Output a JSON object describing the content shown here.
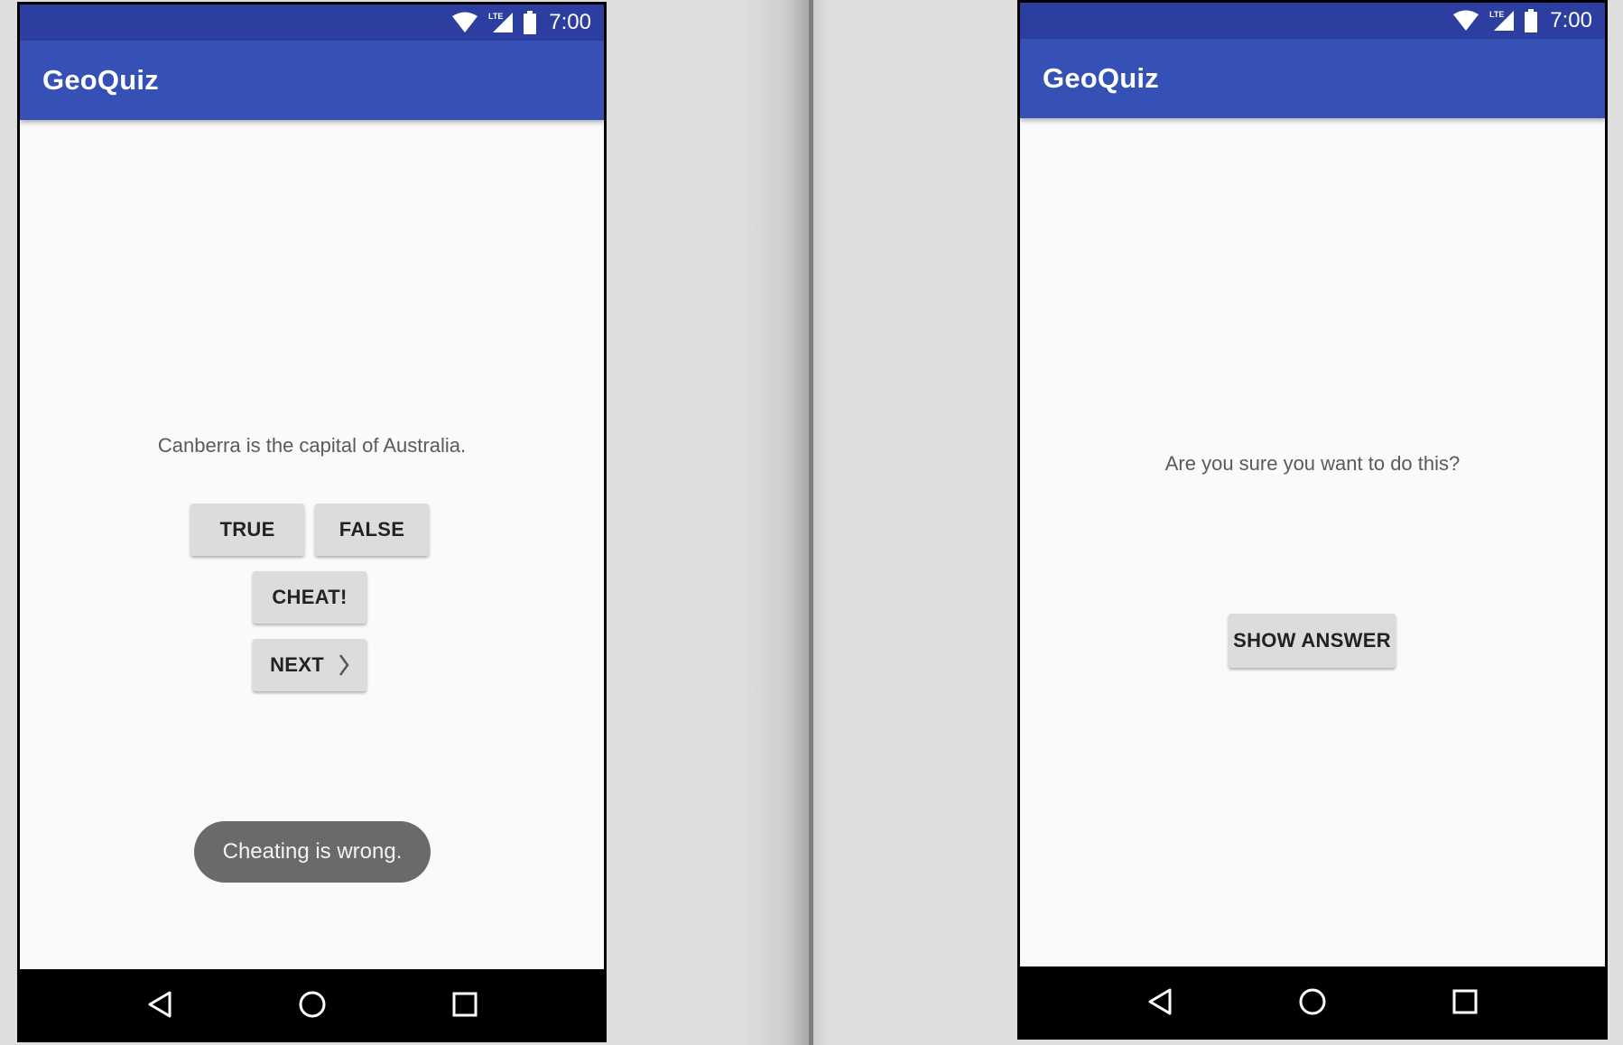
{
  "left_phone": {
    "status_bar": {
      "time": "7:00",
      "icons": [
        "wifi-icon",
        "lte-signal-icon",
        "battery-icon"
      ]
    },
    "app_bar": {
      "title": "GeoQuiz"
    },
    "question": "Canberra is the capital of Australia.",
    "buttons": {
      "true_label": "TRUE",
      "false_label": "FALSE",
      "cheat_label": "CHEAT!",
      "next_label": "NEXT"
    },
    "toast": "Cheating is wrong.",
    "nav_bar": {
      "icons": [
        "back-icon",
        "home-icon",
        "recents-icon"
      ]
    }
  },
  "right_phone": {
    "status_bar": {
      "time": "7:00",
      "icons": [
        "wifi-icon",
        "lte-signal-icon",
        "battery-icon"
      ]
    },
    "app_bar": {
      "title": "GeoQuiz"
    },
    "prompt": "Are you sure you want to do this?",
    "buttons": {
      "show_answer_label": "SHOW ANSWER"
    },
    "nav_bar": {
      "icons": [
        "back-icon",
        "home-icon",
        "recents-icon"
      ]
    }
  },
  "colors": {
    "status_bar": "#2c3fa0",
    "app_bar": "#3551b5",
    "screen_background": "#fafafa",
    "button": "#dcdcdc",
    "toast": "#6a6a6a",
    "nav_bar": "#000000"
  }
}
